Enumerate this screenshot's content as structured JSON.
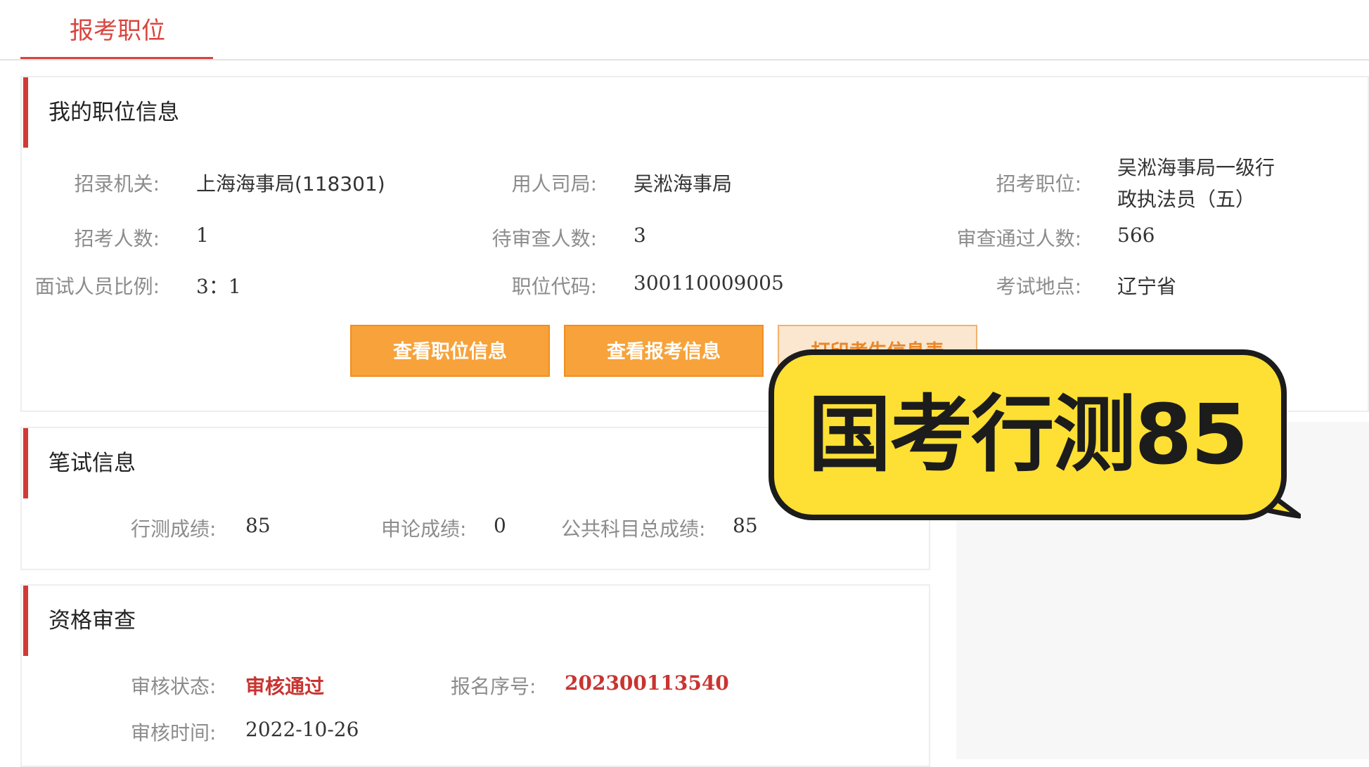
{
  "tab": {
    "label": "报考职位"
  },
  "position_panel": {
    "title": "我的职位信息",
    "fields": {
      "agency_label": "招录机关:",
      "agency_value": "上海海事局(118301)",
      "bureau_label": "用人司局:",
      "bureau_value": "吴淞海事局",
      "post_label": "招考职位:",
      "post_value_line1": "吴淞海事局一级行",
      "post_value_line2": "政执法员（五）",
      "quota_label": "招考人数:",
      "quota_value": "1",
      "pending_label": "待审查人数:",
      "pending_value": "3",
      "passed_label": "审查通过人数:",
      "passed_value": "566",
      "ratio_label": "面试人员比例:",
      "ratio_value": "3：1",
      "code_label": "职位代码:",
      "code_value": "300110009005",
      "place_label": "考试地点:",
      "place_value": "辽宁省"
    },
    "buttons": {
      "view_position": "查看职位信息",
      "view_application": "查看报考信息",
      "print_info": "打印考生信息表"
    }
  },
  "exam_panel": {
    "title": "笔试信息",
    "xingce_label": "行测成绩:",
    "xingce_value": "85",
    "shenlun_label": "申论成绩:",
    "shenlun_value": "0",
    "total_label": "公共科目总成绩:",
    "total_value": "85"
  },
  "review_panel": {
    "title": "资格审查",
    "status_label": "审核状态:",
    "status_value": "审核通过",
    "serial_label": "报名序号:",
    "serial_value": "202300113540",
    "time_label": "审核时间:",
    "time_value": "2022-10-26"
  },
  "overlay": {
    "text": "国考行测85"
  },
  "colors": {
    "accent": "#d9453f",
    "button": "#f7a23a",
    "bubble": "#fde033"
  }
}
